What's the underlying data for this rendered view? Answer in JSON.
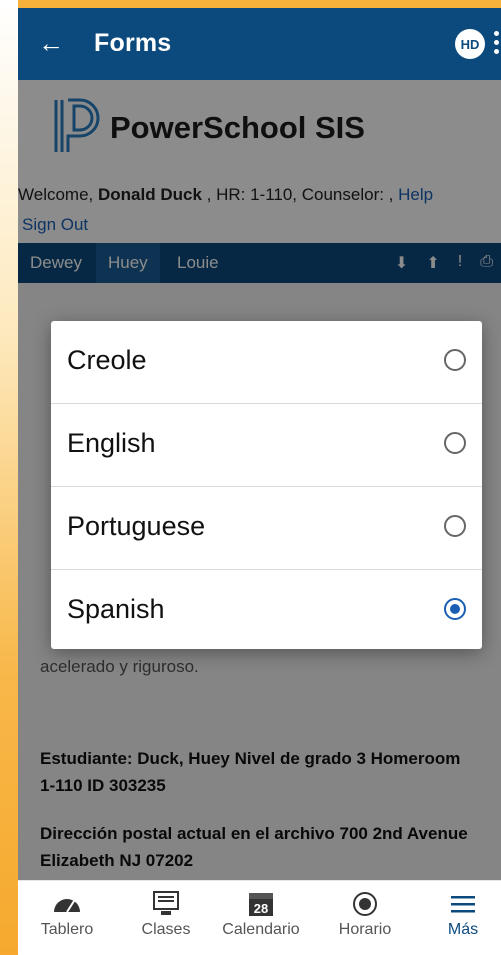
{
  "appbar": {
    "title": "Forms",
    "avatar_initials": "HD"
  },
  "header": {
    "brand": "PowerSchool SIS",
    "welcome_prefix": "Welcome, ",
    "user_name": "Donald Duck",
    "welcome_suffix": " , HR: 1-110, Counselor:  , ",
    "help_label": "Help",
    "signout_label": "Sign Out"
  },
  "student_tabs": [
    {
      "label": "Dewey"
    },
    {
      "label": "Huey",
      "active": true
    },
    {
      "label": "Louie"
    }
  ],
  "background": {
    "partial_text": "acelerado y riguroso.",
    "student_info": "Estudiante: Duck, Huey Nivel de grado 3 Homeroom 1-110 ID 303235",
    "address": "Dirección postal actual en el archivo 700 2nd Avenue Elizabeth NJ 07202",
    "required_marker": "*"
  },
  "language_dialog": {
    "options": [
      {
        "label": "Creole",
        "selected": false
      },
      {
        "label": "English",
        "selected": false
      },
      {
        "label": "Portuguese",
        "selected": false
      },
      {
        "label": "Spanish",
        "selected": true
      }
    ]
  },
  "bottom_nav": [
    {
      "label": "Tablero",
      "icon": "dashboard-icon"
    },
    {
      "label": "Clases",
      "icon": "classes-icon"
    },
    {
      "label": "Calendario",
      "icon": "calendar-icon",
      "badge": "28"
    },
    {
      "label": "Horario",
      "icon": "schedule-icon"
    },
    {
      "label": "Más",
      "icon": "menu-icon",
      "active": true
    }
  ],
  "colors": {
    "primary": "#0c4a7d",
    "accent": "#1a5fb4",
    "side_bg": "#f6b23a"
  }
}
